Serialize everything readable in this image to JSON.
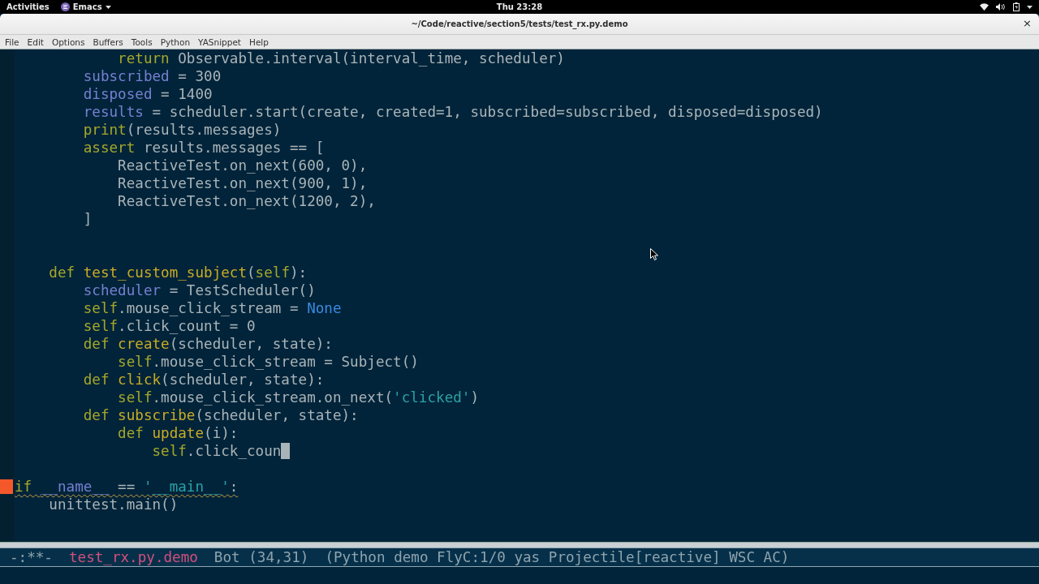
{
  "top_bar": {
    "activities": "Activities",
    "app_menu": "Emacs",
    "clock": "Thu 23:28"
  },
  "window": {
    "title": "~/Code/reactive/section5/tests/test_rx.py.demo",
    "close": "×"
  },
  "menu": [
    "File",
    "Edit",
    "Options",
    "Buffers",
    "Tools",
    "Python",
    "YASnippet",
    "Help"
  ],
  "editor": {
    "lines": [
      {
        "warning": false,
        "tokens": [
          {
            "kind": "keyword",
            "text": "            return"
          },
          {
            "kind": "plain",
            "text": " Observable.interval(interval_time, scheduler)"
          }
        ]
      },
      {
        "warning": false,
        "tokens": [
          {
            "kind": "variable",
            "text": "        subscribed"
          },
          {
            "kind": "plain",
            "text": " = 300"
          }
        ]
      },
      {
        "warning": false,
        "tokens": [
          {
            "kind": "variable",
            "text": "        disposed"
          },
          {
            "kind": "plain",
            "text": " = 1400"
          }
        ]
      },
      {
        "warning": false,
        "tokens": [
          {
            "kind": "variable",
            "text": "        results"
          },
          {
            "kind": "plain",
            "text": " = scheduler.start(create, created=1, subscribed=subscribed, disposed=disposed)"
          }
        ]
      },
      {
        "warning": false,
        "tokens": [
          {
            "kind": "keyword",
            "text": "        print"
          },
          {
            "kind": "plain",
            "text": "(results.messages)"
          }
        ]
      },
      {
        "warning": false,
        "tokens": [
          {
            "kind": "keyword",
            "text": "        assert"
          },
          {
            "kind": "plain",
            "text": " results.messages == ["
          }
        ]
      },
      {
        "warning": false,
        "tokens": [
          {
            "kind": "plain",
            "text": "            ReactiveTest.on_next(600, 0),"
          }
        ]
      },
      {
        "warning": false,
        "tokens": [
          {
            "kind": "plain",
            "text": "            ReactiveTest.on_next(900, 1),"
          }
        ]
      },
      {
        "warning": false,
        "tokens": [
          {
            "kind": "plain",
            "text": "            ReactiveTest.on_next(1200, 2),"
          }
        ]
      },
      {
        "warning": false,
        "tokens": [
          {
            "kind": "plain",
            "text": "        ]"
          }
        ]
      },
      {
        "warning": false
      },
      {
        "warning": false
      },
      {
        "warning": false,
        "tokens": [
          {
            "kind": "keyword",
            "text": "    def "
          },
          {
            "kind": "function",
            "text": "test_custom_subject"
          },
          {
            "kind": "plain",
            "text": "("
          },
          {
            "kind": "keyword",
            "text": "self"
          },
          {
            "kind": "plain",
            "text": "):"
          }
        ]
      },
      {
        "warning": false,
        "tokens": [
          {
            "kind": "variable",
            "text": "        scheduler"
          },
          {
            "kind": "plain",
            "text": " = TestScheduler()"
          }
        ]
      },
      {
        "warning": false,
        "tokens": [
          {
            "kind": "keyword",
            "text": "        self"
          },
          {
            "kind": "plain",
            "text": ".mouse_click_stream = "
          },
          {
            "kind": "constant",
            "text": "None"
          }
        ]
      },
      {
        "warning": false,
        "tokens": [
          {
            "kind": "keyword",
            "text": "        self"
          },
          {
            "kind": "plain",
            "text": ".click_count = 0"
          }
        ]
      },
      {
        "warning": false,
        "tokens": [
          {
            "kind": "keyword",
            "text": "        def "
          },
          {
            "kind": "function",
            "text": "create"
          },
          {
            "kind": "plain",
            "text": "(scheduler, state):"
          }
        ]
      },
      {
        "warning": false,
        "tokens": [
          {
            "kind": "keyword",
            "text": "            self"
          },
          {
            "kind": "plain",
            "text": ".mouse_click_stream = Subject()"
          }
        ]
      },
      {
        "warning": false,
        "tokens": [
          {
            "kind": "keyword",
            "text": "        def "
          },
          {
            "kind": "function",
            "text": "click"
          },
          {
            "kind": "plain",
            "text": "(scheduler, state):"
          }
        ]
      },
      {
        "warning": false,
        "tokens": [
          {
            "kind": "keyword",
            "text": "            self"
          },
          {
            "kind": "plain",
            "text": ".mouse_click_stream.on_next("
          },
          {
            "kind": "string",
            "text": "'clicked'"
          },
          {
            "kind": "plain",
            "text": ")"
          }
        ]
      },
      {
        "warning": false,
        "tokens": [
          {
            "kind": "keyword",
            "text": "        def "
          },
          {
            "kind": "function",
            "text": "subscribe"
          },
          {
            "kind": "plain",
            "text": "(scheduler, state):"
          }
        ]
      },
      {
        "warning": false,
        "tokens": [
          {
            "kind": "keyword",
            "text": "            def "
          },
          {
            "kind": "function",
            "text": "update"
          },
          {
            "kind": "plain",
            "text": "(i):"
          }
        ]
      },
      {
        "warning": false,
        "tokens": [
          {
            "kind": "keyword",
            "text": "                self"
          },
          {
            "kind": "plain",
            "text": ".click_coun"
          },
          {
            "kind": "cursor"
          }
        ]
      },
      {
        "warning": false
      },
      {
        "warning": true,
        "tokens": [
          {
            "kind": "keyword",
            "text": "if "
          },
          {
            "kind": "variable",
            "text": "__name__"
          },
          {
            "kind": "plain",
            "text": " == "
          },
          {
            "kind": "string",
            "text": "'__main__'"
          },
          {
            "kind": "plain",
            "text": ":"
          }
        ]
      },
      {
        "warning": false,
        "tokens": [
          {
            "kind": "plain",
            "text": "    unittest.main()"
          }
        ]
      }
    ]
  },
  "mode_line": {
    "status": "-:**-",
    "buffer": "test_rx.py.demo",
    "position": "Bot (34,31)",
    "modes": "(Python demo FlyC:1/0 yas Projectile[reactive] WSC AC)"
  }
}
